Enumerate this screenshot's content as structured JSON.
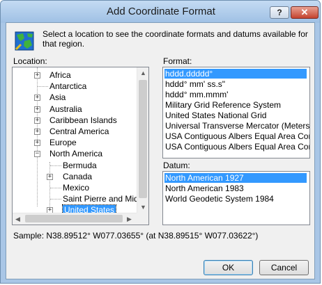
{
  "window": {
    "title": "Add Coordinate Format",
    "help_glyph": "?",
    "close_glyph": "✕"
  },
  "description": "Select a location to see the coordinate formats and datums available for that region.",
  "location": {
    "label": "Location:",
    "nodes": [
      {
        "label": "Africa",
        "expander": "+"
      },
      {
        "label": "Antarctica",
        "expander": ""
      },
      {
        "label": "Asia",
        "expander": "+"
      },
      {
        "label": "Australia",
        "expander": "+"
      },
      {
        "label": "Caribbean Islands",
        "expander": "+"
      },
      {
        "label": "Central America",
        "expander": "+"
      },
      {
        "label": "Europe",
        "expander": "+"
      },
      {
        "label": "North America",
        "expander": "−"
      },
      {
        "label": "Bermuda",
        "expander": ""
      },
      {
        "label": "Canada",
        "expander": "+"
      },
      {
        "label": "Mexico",
        "expander": ""
      },
      {
        "label": "Saint Pierre and Miquelo",
        "expander": ""
      },
      {
        "label": "United States",
        "expander": "+",
        "selected": true
      }
    ]
  },
  "format": {
    "label": "Format:",
    "items": [
      "hddd.ddddd°",
      "hddd° mm' ss.s\"",
      "hddd° mm.mmm'",
      "Military Grid Reference System",
      "United States National Grid",
      "Universal Transverse Mercator (Meters)",
      "USA Contiguous Albers Equal Area Conic",
      "USA Contiguous Albers Equal Area Conic U"
    ],
    "selected_index": 0
  },
  "datum": {
    "label": "Datum:",
    "items": [
      "North American 1927",
      "North American 1983",
      "World Geodetic System 1984"
    ],
    "selected_index": 0
  },
  "sample": "Sample: N38.89512°  W077.03655° (at N38.89515°  W077.03622°)",
  "buttons": {
    "ok": "OK",
    "cancel": "Cancel"
  },
  "colors": {
    "selection": "#3399ff",
    "frame": "#a9c6e6"
  }
}
